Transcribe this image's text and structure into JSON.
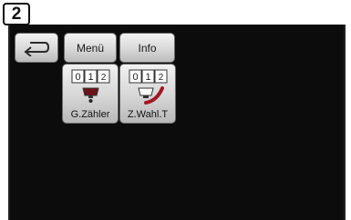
{
  "screen_badge": "2",
  "toolbar": {
    "back_icon": "back-arrow-icon",
    "menu_label": "Menü",
    "info_label": "Info"
  },
  "tiles": [
    {
      "label": "G.Zähler",
      "icon": "counter-cup-icon"
    },
    {
      "label": "Z.Wahl.T",
      "icon": "counter-cup-select-icon"
    }
  ]
}
